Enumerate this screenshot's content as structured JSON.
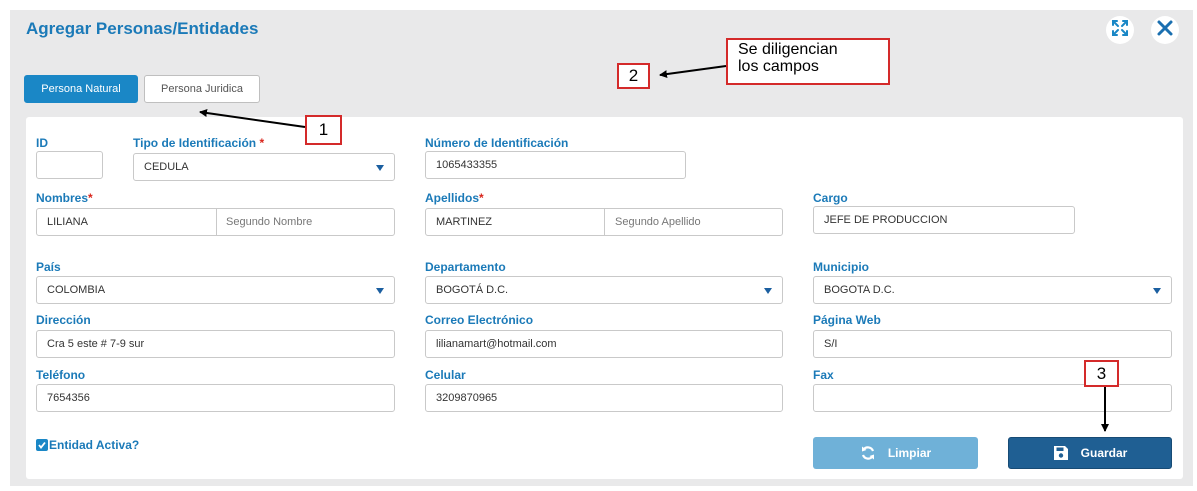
{
  "dialog": {
    "title": "Agregar Personas/Entidades",
    "tabs": [
      {
        "label": "Persona Natural",
        "active": true
      },
      {
        "label": "Persona Juridica",
        "active": false
      }
    ]
  },
  "form": {
    "id": {
      "label": "ID",
      "value": ""
    },
    "tipo_identificacion": {
      "label": "Tipo de Identificación",
      "required_mark": "*",
      "value": "CEDULA"
    },
    "numero_identificacion": {
      "label": "Número de Identificación",
      "value": "1065433355"
    },
    "nombres": {
      "label": "Nombres",
      "required_mark": "*",
      "first": "LILIANA",
      "second_placeholder": "Segundo Nombre"
    },
    "apellidos": {
      "label": "Apellidos",
      "required_mark": "*",
      "first": "MARTINEZ",
      "second_placeholder": "Segundo Apellido"
    },
    "cargo": {
      "label": "Cargo",
      "value": "JEFE DE PRODUCCION"
    },
    "pais": {
      "label": "País",
      "value": "COLOMBIA"
    },
    "departamento": {
      "label": "Departamento",
      "value": "BOGOTÁ D.C."
    },
    "municipio": {
      "label": "Municipio",
      "value": "BOGOTA D.C."
    },
    "direccion": {
      "label": "Dirección",
      "value": "Cra 5 este # 7-9 sur"
    },
    "correo": {
      "label": "Correo Electrónico",
      "value": "lilianamart@hotmail.com"
    },
    "pagina_web": {
      "label": "Página Web",
      "value": "S/I"
    },
    "telefono": {
      "label": "Teléfono",
      "value": "7654356"
    },
    "celular": {
      "label": "Celular",
      "value": "3209870965"
    },
    "fax": {
      "label": "Fax",
      "value": ""
    },
    "entidad_activa": {
      "label": "Entidad Activa?",
      "checked": true
    }
  },
  "buttons": {
    "limpiar": "Limpiar",
    "guardar": "Guardar"
  },
  "annotations": {
    "callout_1": "1",
    "callout_2": "2",
    "callout_3": "3",
    "note_line1": "Se diligencian",
    "note_line2": "los campos"
  },
  "colors": {
    "accent": "#1a87c6",
    "primary_button": "#1f5f93",
    "callout_border": "#d42a2a"
  },
  "icons": [
    "expand-icon",
    "close-icon",
    "caret-down-icon",
    "refresh-icon",
    "save-icon",
    "check-icon"
  ]
}
